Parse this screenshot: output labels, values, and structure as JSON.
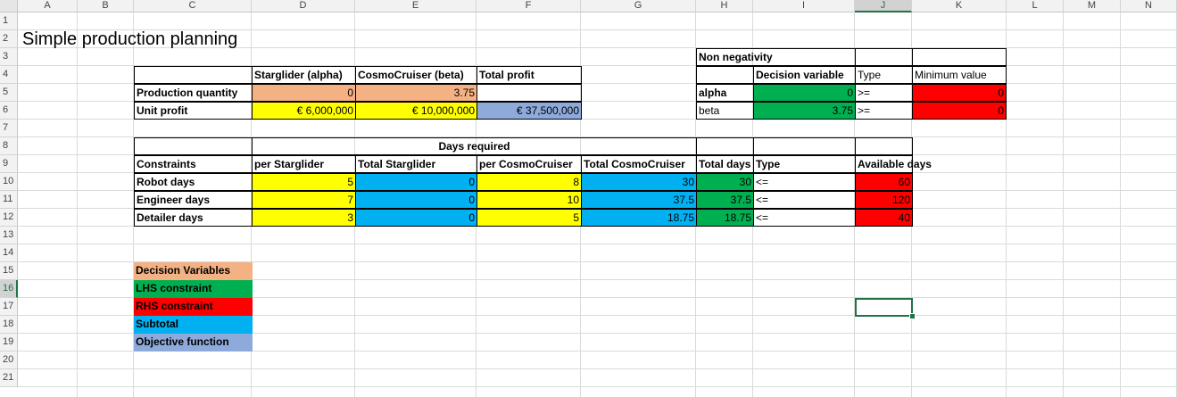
{
  "sheet": {
    "columns": [
      "A",
      "B",
      "C",
      "D",
      "E",
      "F",
      "G",
      "H",
      "I",
      "J",
      "K",
      "L",
      "M",
      "N"
    ],
    "rows": [
      "1",
      "2",
      "3",
      "4",
      "5",
      "6",
      "7",
      "8",
      "9",
      "10",
      "11",
      "12",
      "13",
      "14",
      "15",
      "16",
      "17",
      "18",
      "19",
      "20",
      "21"
    ],
    "title": "Simple production planning"
  },
  "products": {
    "header_alpha": "Starglider (alpha)",
    "header_beta": "CosmoCruiser (beta)",
    "header_total": "Total profit",
    "row_quantity": "Production quantity",
    "row_profit": "Unit profit",
    "qty_alpha": "0",
    "qty_beta": "3.75",
    "profit_alpha": "€ 6,000,000",
    "profit_beta": "€ 10,000,000",
    "total_profit": "€ 37,500,000"
  },
  "nonneg": {
    "title": "Non negativity",
    "col_decision": "Decision variable",
    "col_type": "Type",
    "col_min": "Minimum value",
    "rows": [
      {
        "label": "alpha",
        "value": "0",
        "type": ">=",
        "min": "0"
      },
      {
        "label": "beta",
        "value": "3.75",
        "type": ">=",
        "min": "0"
      }
    ]
  },
  "constraints": {
    "group_header": "Days required",
    "col_constraints": "Constraints",
    "col_per_starglider": "per Starglider",
    "col_total_starglider": "Total Starglider",
    "col_per_cosmo": "per CosmoCruiser",
    "col_total_cosmo": "Total CosmoCruiser",
    "col_total_days": "Total days",
    "col_type": "Type",
    "col_available": "Available days",
    "rows": [
      {
        "label": "Robot days",
        "per_s": "5",
        "tot_s": "0",
        "per_c": "8",
        "tot_c": "30",
        "total": "30",
        "type": "<=",
        "avail": "60"
      },
      {
        "label": "Engineer days",
        "per_s": "7",
        "tot_s": "0",
        "per_c": "10",
        "tot_c": "37.5",
        "total": "37.5",
        "type": "<=",
        "avail": "120"
      },
      {
        "label": "Detailer days",
        "per_s": "3",
        "tot_s": "0",
        "per_c": "5",
        "tot_c": "18.75",
        "total": "18.75",
        "type": "<=",
        "avail": "40"
      }
    ]
  },
  "legend": [
    {
      "label": "Decision Variables",
      "color": "#f4b183"
    },
    {
      "label": "LHS constraint",
      "color": "#00b050"
    },
    {
      "label": "RHS constraint",
      "color": "#ff0000"
    },
    {
      "label": "Subtotal",
      "color": "#00b0f0"
    },
    {
      "label": "Objective function",
      "color": "#8eaadb"
    }
  ],
  "colors": {
    "decision": "#f4b183",
    "input": "#ffff00",
    "subtotal": "#00b0f0",
    "lhs": "#00b050",
    "rhs": "#ff0000",
    "objective": "#8eaadb",
    "selection": "#217346"
  }
}
